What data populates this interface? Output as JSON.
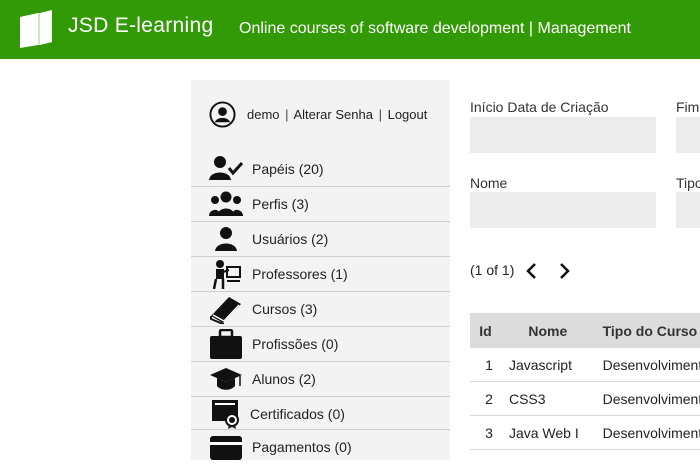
{
  "header": {
    "app_title": "JSD E-learning",
    "subtitle": "Online courses of software development | Management",
    "background_color": "#339a07"
  },
  "user": {
    "name": "demo",
    "change_password": "Alterar Senha",
    "logout": "Logout",
    "separator": "|",
    "icon": "user-circle-icon"
  },
  "menu": [
    {
      "label": "Papéis (20)",
      "icon": "user-check-icon"
    },
    {
      "label": "Perfis (3)",
      "icon": "users-group-icon"
    },
    {
      "label": "Usuários (2)",
      "icon": "user-icon"
    },
    {
      "label": "Professores (1)",
      "icon": "teacher-icon"
    },
    {
      "label": "Cursos (3)",
      "icon": "book-icon"
    },
    {
      "label": "Profissões (0)",
      "icon": "briefcase-icon"
    },
    {
      "label": "Alunos (2)",
      "icon": "graduation-cap-icon"
    },
    {
      "label": "Certificados (0)",
      "icon": "certificate-icon"
    },
    {
      "label": "Pagamentos (0)",
      "icon": "credit-card-icon"
    }
  ],
  "filters": {
    "inicio_label": "Início Data de Criação",
    "inicio_value": "",
    "fim_label": "Fim",
    "fim_value": "",
    "nome_label": "Nome",
    "nome_value": "",
    "tipo_label": "Tipo",
    "tipo_value": ""
  },
  "pager": {
    "info": "(1 of 1)",
    "prev_icon": "chevron-left-icon",
    "next_icon": "chevron-right-icon"
  },
  "table": {
    "columns": [
      "Id",
      "Nome",
      "Tipo do Curso"
    ],
    "rows": [
      {
        "id": "1",
        "nome": "Javascript",
        "tipo": "Desenvolvimento"
      },
      {
        "id": "2",
        "nome": "CSS3",
        "tipo": "Desenvolvimento"
      },
      {
        "id": "3",
        "nome": "Java Web I",
        "tipo": "Desenvolvimento"
      }
    ]
  }
}
